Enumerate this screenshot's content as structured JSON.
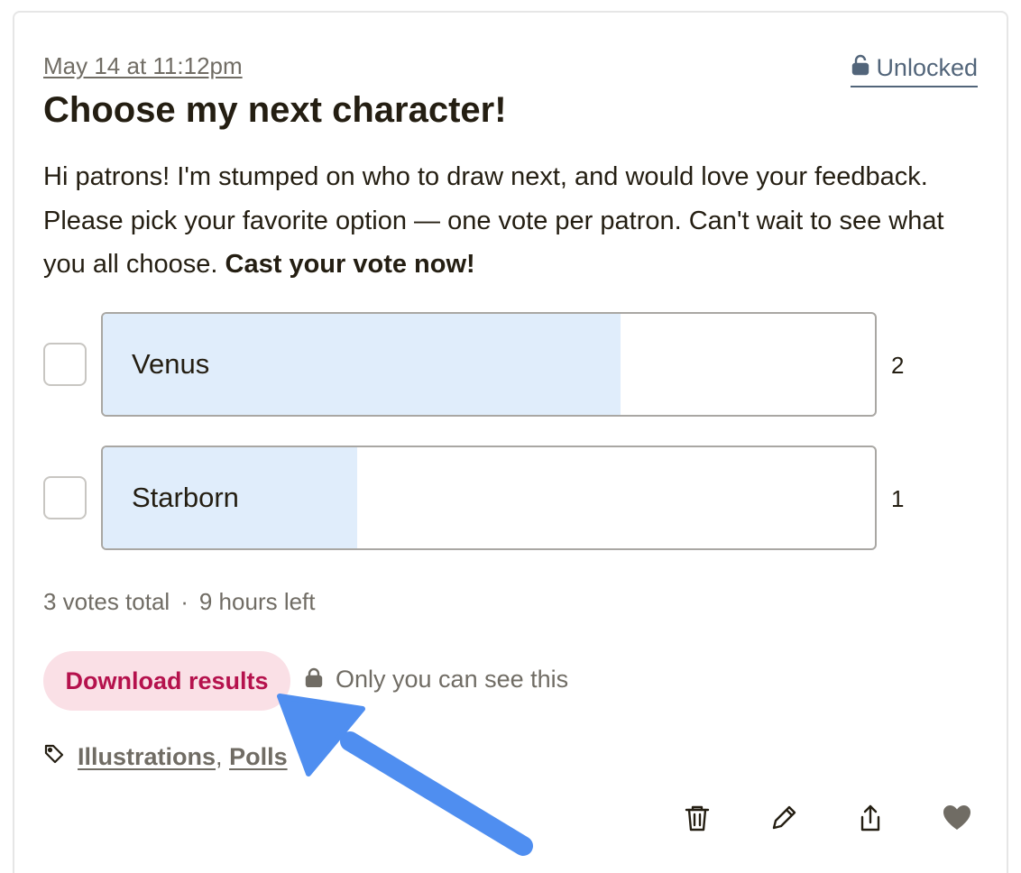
{
  "post": {
    "timestamp": "May 14 at 11:12pm",
    "access": "Unlocked",
    "title": "Choose my next character!",
    "body_text": "Hi patrons! I'm stumped on who to draw next, and would love your feedback. Please pick your favorite option — one vote per patron. Can't wait to see what you all choose.",
    "body_bold": "Cast your vote now!"
  },
  "poll": {
    "options": [
      {
        "label": "Venus",
        "votes": "2",
        "share": 0.67
      },
      {
        "label": "Starborn",
        "votes": "1",
        "share": 0.33
      }
    ],
    "total": "3 votes total",
    "separator": "·",
    "time_left": "9 hours left"
  },
  "results": {
    "download_label": "Download results",
    "private_note": "Only you can see this"
  },
  "tags": {
    "items": [
      "Illustrations",
      "Polls"
    ],
    "separator": ","
  },
  "icons": {
    "lock_open": "unlock-icon",
    "lock": "lock-icon",
    "tag": "tag-icon",
    "delete": "trash-icon",
    "edit": "pencil-icon",
    "share": "share-icon",
    "like": "heart-icon"
  },
  "colors": {
    "bar_fill": "#e0edfb",
    "download_bg": "#fae0e6",
    "download_text": "#b5124d",
    "arrow": "#4f8ef0",
    "link_blue": "#52657a"
  }
}
